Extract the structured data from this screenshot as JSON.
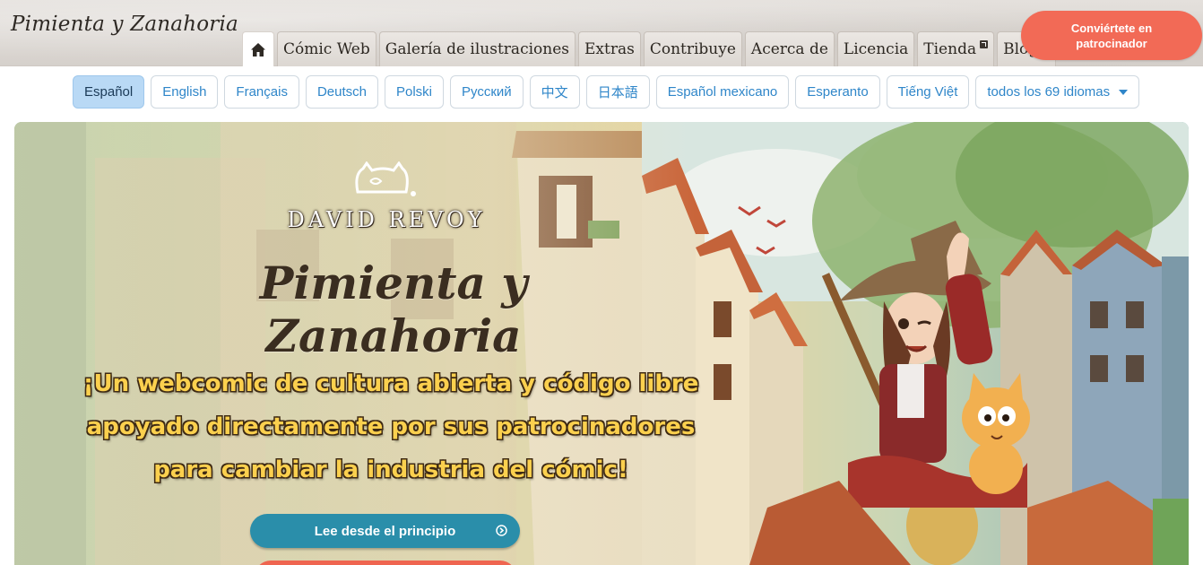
{
  "header": {
    "logo": "Pimienta y Zanahoria",
    "tabs": [
      {
        "label": "Cómic Web"
      },
      {
        "label": "Galería de ilustraciones"
      },
      {
        "label": "Extras"
      },
      {
        "label": "Contribuye"
      },
      {
        "label": "Acerca de"
      },
      {
        "label": "Licencia"
      },
      {
        "label": "Tienda",
        "external": true
      },
      {
        "label": "Blog",
        "external": true
      }
    ],
    "home_icon": "home-icon",
    "sponsor_button": "Conviértete en patrocinador",
    "colors": {
      "sponsor": "#f26a56",
      "header_bg": "#dcd7d2"
    }
  },
  "languages": {
    "items": [
      "Español",
      "English",
      "Français",
      "Deutsch",
      "Polski",
      "Русский",
      "中文",
      "日本語",
      "Español mexicano",
      "Esperanto",
      "Tiếng Việt"
    ],
    "active": "Español",
    "all_label": "todos los 69 idiomas",
    "colors": {
      "link": "#2f86c9",
      "active_bg": "#b9d9f5"
    }
  },
  "hero": {
    "author": "DAVID REVOY",
    "title": "Pimienta y Zanahoria",
    "tagline": "¡Un webcomic de cultura abierta y código libre apoyado directamente por sus patrocinadores para cambiar la industria del cómic!",
    "read_button": "Lee desde el principio",
    "colors": {
      "read_button": "#2a8eaa",
      "tagline": "#fbd04e"
    }
  }
}
